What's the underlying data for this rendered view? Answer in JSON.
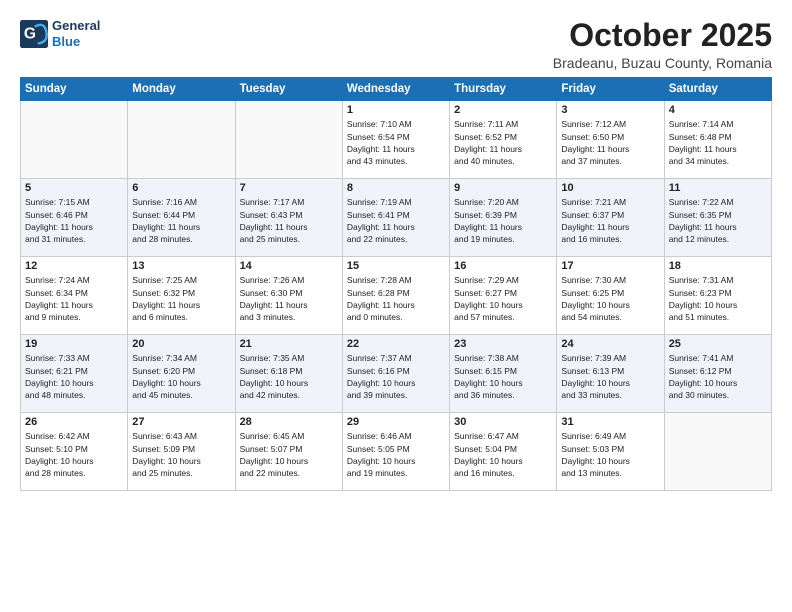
{
  "header": {
    "logo_line1": "General",
    "logo_line2": "Blue",
    "month": "October 2025",
    "location": "Bradeanu, Buzau County, Romania"
  },
  "weekdays": [
    "Sunday",
    "Monday",
    "Tuesday",
    "Wednesday",
    "Thursday",
    "Friday",
    "Saturday"
  ],
  "weeks": [
    [
      {
        "day": "",
        "info": ""
      },
      {
        "day": "",
        "info": ""
      },
      {
        "day": "",
        "info": ""
      },
      {
        "day": "1",
        "info": "Sunrise: 7:10 AM\nSunset: 6:54 PM\nDaylight: 11 hours\nand 43 minutes."
      },
      {
        "day": "2",
        "info": "Sunrise: 7:11 AM\nSunset: 6:52 PM\nDaylight: 11 hours\nand 40 minutes."
      },
      {
        "day": "3",
        "info": "Sunrise: 7:12 AM\nSunset: 6:50 PM\nDaylight: 11 hours\nand 37 minutes."
      },
      {
        "day": "4",
        "info": "Sunrise: 7:14 AM\nSunset: 6:48 PM\nDaylight: 11 hours\nand 34 minutes."
      }
    ],
    [
      {
        "day": "5",
        "info": "Sunrise: 7:15 AM\nSunset: 6:46 PM\nDaylight: 11 hours\nand 31 minutes."
      },
      {
        "day": "6",
        "info": "Sunrise: 7:16 AM\nSunset: 6:44 PM\nDaylight: 11 hours\nand 28 minutes."
      },
      {
        "day": "7",
        "info": "Sunrise: 7:17 AM\nSunset: 6:43 PM\nDaylight: 11 hours\nand 25 minutes."
      },
      {
        "day": "8",
        "info": "Sunrise: 7:19 AM\nSunset: 6:41 PM\nDaylight: 11 hours\nand 22 minutes."
      },
      {
        "day": "9",
        "info": "Sunrise: 7:20 AM\nSunset: 6:39 PM\nDaylight: 11 hours\nand 19 minutes."
      },
      {
        "day": "10",
        "info": "Sunrise: 7:21 AM\nSunset: 6:37 PM\nDaylight: 11 hours\nand 16 minutes."
      },
      {
        "day": "11",
        "info": "Sunrise: 7:22 AM\nSunset: 6:35 PM\nDaylight: 11 hours\nand 12 minutes."
      }
    ],
    [
      {
        "day": "12",
        "info": "Sunrise: 7:24 AM\nSunset: 6:34 PM\nDaylight: 11 hours\nand 9 minutes."
      },
      {
        "day": "13",
        "info": "Sunrise: 7:25 AM\nSunset: 6:32 PM\nDaylight: 11 hours\nand 6 minutes."
      },
      {
        "day": "14",
        "info": "Sunrise: 7:26 AM\nSunset: 6:30 PM\nDaylight: 11 hours\nand 3 minutes."
      },
      {
        "day": "15",
        "info": "Sunrise: 7:28 AM\nSunset: 6:28 PM\nDaylight: 11 hours\nand 0 minutes."
      },
      {
        "day": "16",
        "info": "Sunrise: 7:29 AM\nSunset: 6:27 PM\nDaylight: 10 hours\nand 57 minutes."
      },
      {
        "day": "17",
        "info": "Sunrise: 7:30 AM\nSunset: 6:25 PM\nDaylight: 10 hours\nand 54 minutes."
      },
      {
        "day": "18",
        "info": "Sunrise: 7:31 AM\nSunset: 6:23 PM\nDaylight: 10 hours\nand 51 minutes."
      }
    ],
    [
      {
        "day": "19",
        "info": "Sunrise: 7:33 AM\nSunset: 6:21 PM\nDaylight: 10 hours\nand 48 minutes."
      },
      {
        "day": "20",
        "info": "Sunrise: 7:34 AM\nSunset: 6:20 PM\nDaylight: 10 hours\nand 45 minutes."
      },
      {
        "day": "21",
        "info": "Sunrise: 7:35 AM\nSunset: 6:18 PM\nDaylight: 10 hours\nand 42 minutes."
      },
      {
        "day": "22",
        "info": "Sunrise: 7:37 AM\nSunset: 6:16 PM\nDaylight: 10 hours\nand 39 minutes."
      },
      {
        "day": "23",
        "info": "Sunrise: 7:38 AM\nSunset: 6:15 PM\nDaylight: 10 hours\nand 36 minutes."
      },
      {
        "day": "24",
        "info": "Sunrise: 7:39 AM\nSunset: 6:13 PM\nDaylight: 10 hours\nand 33 minutes."
      },
      {
        "day": "25",
        "info": "Sunrise: 7:41 AM\nSunset: 6:12 PM\nDaylight: 10 hours\nand 30 minutes."
      }
    ],
    [
      {
        "day": "26",
        "info": "Sunrise: 6:42 AM\nSunset: 5:10 PM\nDaylight: 10 hours\nand 28 minutes."
      },
      {
        "day": "27",
        "info": "Sunrise: 6:43 AM\nSunset: 5:09 PM\nDaylight: 10 hours\nand 25 minutes."
      },
      {
        "day": "28",
        "info": "Sunrise: 6:45 AM\nSunset: 5:07 PM\nDaylight: 10 hours\nand 22 minutes."
      },
      {
        "day": "29",
        "info": "Sunrise: 6:46 AM\nSunset: 5:05 PM\nDaylight: 10 hours\nand 19 minutes."
      },
      {
        "day": "30",
        "info": "Sunrise: 6:47 AM\nSunset: 5:04 PM\nDaylight: 10 hours\nand 16 minutes."
      },
      {
        "day": "31",
        "info": "Sunrise: 6:49 AM\nSunset: 5:03 PM\nDaylight: 10 hours\nand 13 minutes."
      },
      {
        "day": "",
        "info": ""
      }
    ]
  ]
}
